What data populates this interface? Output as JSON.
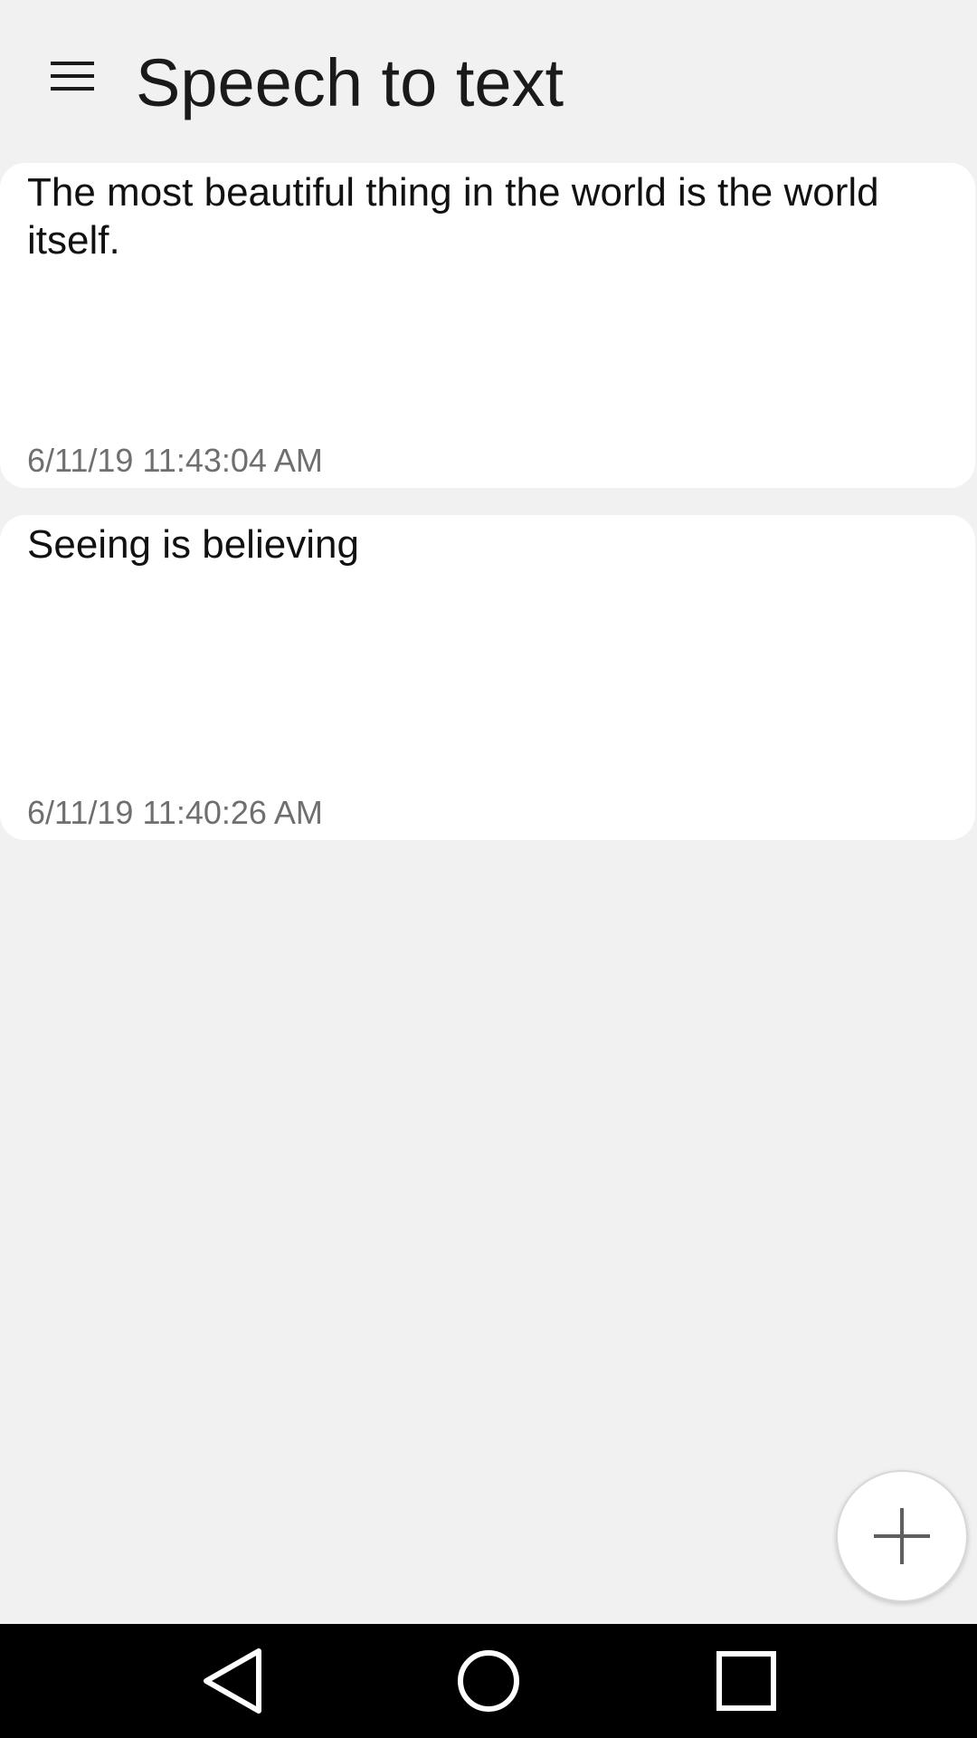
{
  "app_bar": {
    "title": "Speech to text",
    "menu_icon": "hamburger-menu-icon"
  },
  "notes": [
    {
      "text": "The most beautiful thing in the world is the world itself.",
      "timestamp": "6/11/19 11:43:04 AM"
    },
    {
      "text": "Seeing is believing",
      "timestamp": "6/11/19 11:40:26 AM"
    }
  ],
  "fab": {
    "icon": "plus-icon"
  },
  "system_nav": {
    "back_icon": "back-triangle-icon",
    "home_icon": "home-circle-icon",
    "recents_icon": "recents-square-icon"
  },
  "colors": {
    "background": "#f1f1f1",
    "card": "#ffffff",
    "title_text": "#1a1a1a",
    "timestamp_text": "#6f6f6f",
    "nav_bar": "#000000"
  }
}
